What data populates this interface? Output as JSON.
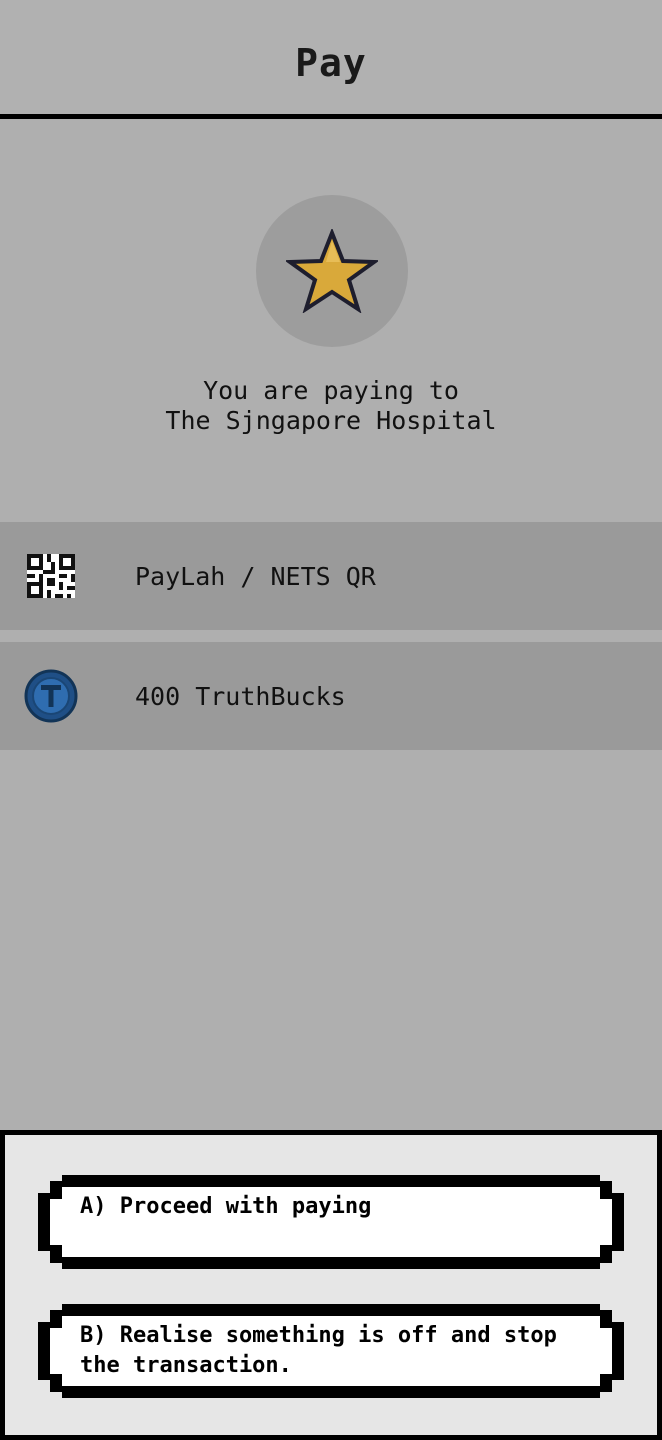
{
  "header": {
    "title": "Pay"
  },
  "payee": {
    "icon": "star-icon",
    "line1": "You are paying to",
    "line2": "The Sjngapore Hospital"
  },
  "methods": [
    {
      "icon": "qr-code-icon",
      "label": "PayLah / NETS QR"
    },
    {
      "icon": "truthbucks-coin-icon",
      "label": "400 TruthBucks"
    }
  ],
  "choices": [
    {
      "label": "A) Proceed with paying"
    },
    {
      "label": "B) Realise something is off and stop the transaction."
    }
  ],
  "colors": {
    "background": "#afafaf",
    "row": "#9a9a9a",
    "panel": "#e6e6e6",
    "star": "#d9a93a",
    "coin": "#2f6db0"
  }
}
